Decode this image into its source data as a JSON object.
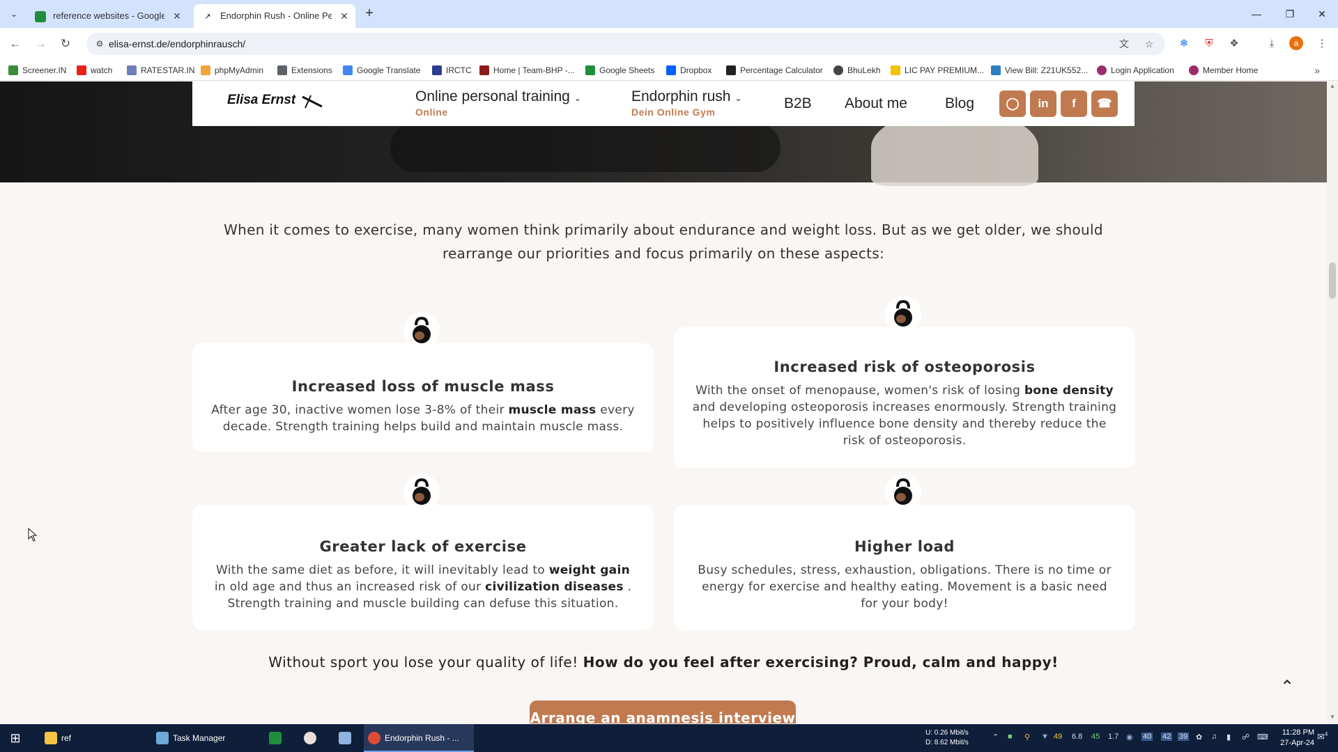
{
  "browser": {
    "tabs": [
      {
        "title": "reference websites - Google Sh",
        "active": false
      },
      {
        "title": "Endorphin Rush - Online Perso",
        "active": true
      }
    ],
    "url": "elisa-ernst.de/endorphinrausch/",
    "bookmarks": [
      "Screener.IN",
      "watch",
      "RATESTAR.IN",
      "phpMyAdmin",
      "Extensions",
      "Google Translate",
      "IRCTC",
      "Home | Team-BHP -...",
      "Google Sheets",
      "Dropbox",
      "Percentage Calculator",
      "BhuLekh",
      "LIC PAY PREMIUM...",
      "View Bill: Z21UK552...",
      "Login Application",
      "Member Home"
    ],
    "profile_initial": "a"
  },
  "site": {
    "logo": "Elisa Ernst",
    "nav": [
      {
        "label": "Online personal training",
        "sub": "Online"
      },
      {
        "label": "Endorphin rush",
        "sub": "Dein Online Gym"
      }
    ],
    "nav_plain": [
      "B2B",
      "About me",
      "Blog"
    ],
    "social_icons": [
      "instagram-icon",
      "linkedin-icon",
      "facebook-icon",
      "whatsapp-icon"
    ]
  },
  "content": {
    "intro": "When it comes to exercise, many women think primarily about endurance and weight loss. But as we get older, we should rearrange our priorities and focus primarily on these aspects:",
    "cards": [
      {
        "title": "Increased loss of muscle mass",
        "text_1": "After age 30, inactive women lose 3-8% of their ",
        "bold_1": "muscle mass",
        "text_2": " every decade. Strength training helps build and maintain muscle mass."
      },
      {
        "title": "Increased risk of osteoporosis",
        "text_1": "With the onset of menopause, women's risk of losing ",
        "bold_1": "bone density",
        "text_2": " and developing osteoporosis increases enormously. Strength training helps to positively influence bone density and thereby reduce the risk of osteoporosis."
      },
      {
        "title": "Greater lack of exercise",
        "text_1": "With the same diet as before, it will inevitably lead to ",
        "bold_1": "weight gain",
        "text_2": " in old age and thus an increased risk of our ",
        "bold_2": "civilization diseases",
        "text_3": " . Strength training and muscle building can defuse this situation."
      },
      {
        "title": "Higher load",
        "text_1": "Busy schedules, stress, exhaustion, obligations. There is no time or energy for exercise and healthy eating. Movement is a basic need for your body!"
      }
    ],
    "claim_normal": "Without sport you lose your quality of life! ",
    "claim_bold": "How do you feel after exercising? Proud, calm and happy!",
    "cta": "Arrange an anamnesis interview"
  },
  "taskbar": {
    "items": [
      "ref",
      "Task Manager",
      "Endorphin Rush - ..."
    ],
    "net_up": "U:  0.26 Mbit/s",
    "net_down": "D:  8.62 Mbit/s",
    "tray_values": [
      "49",
      "6.8",
      "45",
      "1.7",
      "40",
      "42",
      "39"
    ],
    "time": "11:28 PM",
    "date": "27-Apr-24",
    "notifications": "4"
  },
  "colors": {
    "accent": "#c17a50",
    "page_bg": "#faf6f3",
    "tabbar": "#d3e3fd",
    "taskbar": "#0f1f3a"
  }
}
